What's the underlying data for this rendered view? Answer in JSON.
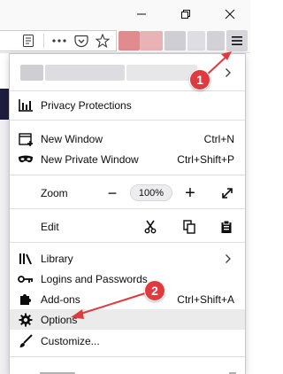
{
  "window": {
    "minimize_icon": "minimize-icon",
    "restore_icon": "restore-icon",
    "close_icon": "close-icon"
  },
  "toolbar": {
    "icons": [
      "reader-view-icon",
      "page-actions-icon",
      "pocket-icon",
      "bookmark-star-icon",
      "hamburger-menu-icon"
    ],
    "blurred_colors": [
      "#e08c8e",
      "#e9b2b4",
      "#cfcfd3",
      "#dedee2",
      "#d2d2d6"
    ]
  },
  "menu": {
    "account_blur_colors": [
      "#cfcfd3",
      "#dddde1",
      "#e7e7ea"
    ],
    "items": {
      "privacy": "Privacy Protections",
      "new_window": {
        "label": "New Window",
        "shortcut": "Ctrl+N"
      },
      "private_window": {
        "label": "New Private Window",
        "shortcut": "Ctrl+Shift+P"
      },
      "zoom": {
        "label": "Zoom",
        "value": "100%",
        "minus": "−",
        "plus": "+"
      },
      "edit": {
        "label": "Edit"
      },
      "library": "Library",
      "logins": "Logins and Passwords",
      "addons": {
        "label": "Add-ons",
        "shortcut": "Ctrl+Shift+A"
      },
      "options": "Options",
      "customize": "Customize..."
    }
  },
  "annotations": {
    "badge_1": "1",
    "badge_2": "2",
    "color": "#e03a3e"
  }
}
